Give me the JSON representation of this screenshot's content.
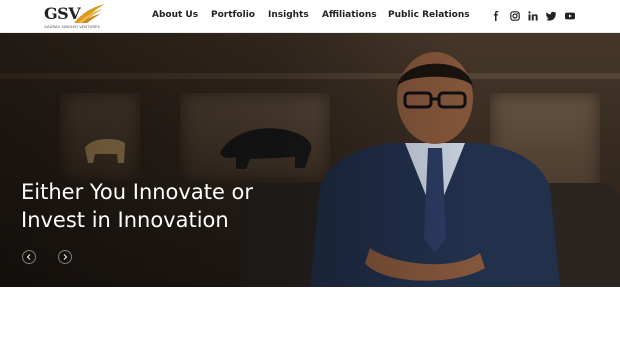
{
  "brand": {
    "logo_text": "GSV",
    "logo_subtitle": "GAURAV SINGHVI VENTURES"
  },
  "nav": {
    "items": [
      {
        "label": "About Us"
      },
      {
        "label": "Portfolio"
      },
      {
        "label": "Insights"
      },
      {
        "label": "Affiliations"
      },
      {
        "label": "Public Relations"
      }
    ]
  },
  "social": {
    "icons": [
      "facebook-icon",
      "instagram-icon",
      "linkedin-icon",
      "twitter-icon",
      "youtube-icon"
    ]
  },
  "hero": {
    "headline_line1": "Either You Innovate or",
    "headline_line2": "Invest in Innovation",
    "prev_icon": "chevron-left-icon",
    "next_icon": "chevron-right-icon"
  },
  "colors": {
    "accent_gold": "#d99a1e",
    "text_dark": "#222222",
    "hero_text": "#ffffff"
  }
}
